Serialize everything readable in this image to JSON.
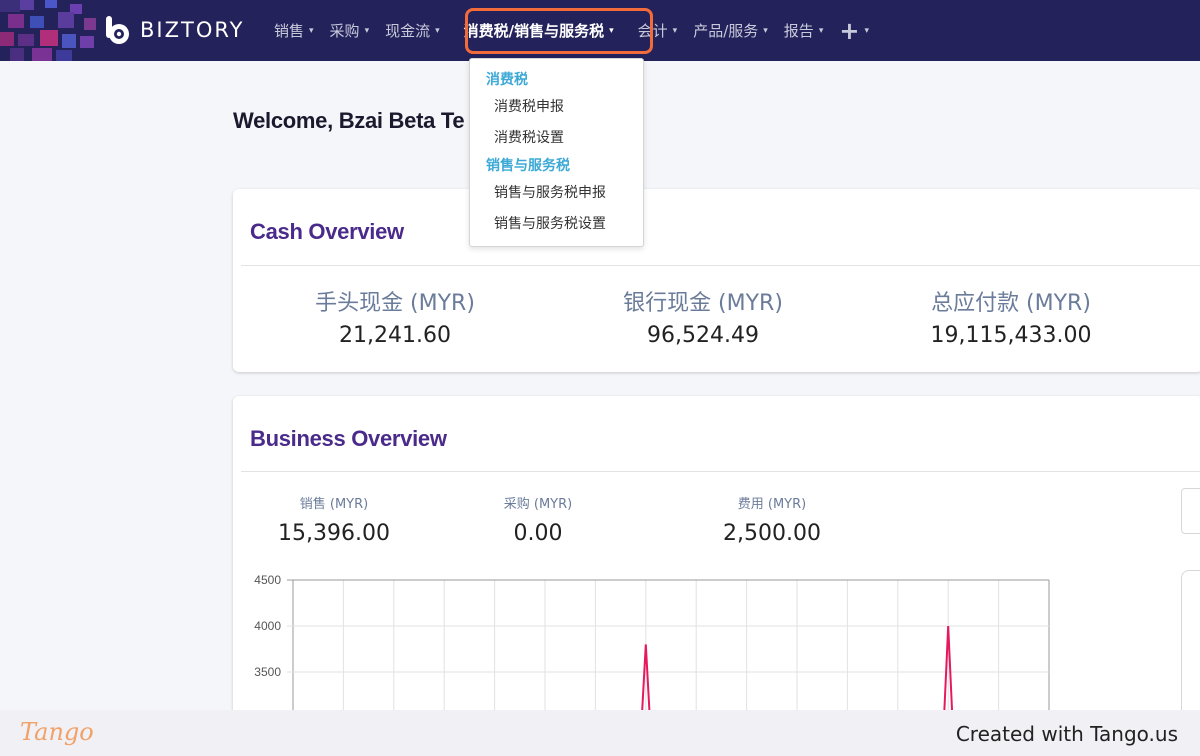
{
  "brand": {
    "name": "BIZTORY",
    "logo_icon": "biztory-b-logo"
  },
  "nav": {
    "items": [
      {
        "label": "销售",
        "active": false
      },
      {
        "label": "采购",
        "active": false
      },
      {
        "label": "现金流",
        "active": false
      },
      {
        "label": "消费税/销售与服务税",
        "active": true
      },
      {
        "label": "会计",
        "active": false
      },
      {
        "label": "产品/服务",
        "active": false
      },
      {
        "label": "报告",
        "active": false
      }
    ],
    "plus_icon": "plus-icon",
    "plus_label": "+",
    "caret": "▾"
  },
  "dropdown": {
    "sections": [
      {
        "header": "消费税",
        "items": [
          "消费税申报",
          "消费税设置"
        ]
      },
      {
        "header": "销售与服务税",
        "items": [
          "销售与服务税申报",
          "销售与服务税设置"
        ]
      }
    ]
  },
  "welcome": {
    "text": "Welcome, Bzai Beta Te"
  },
  "cash_overview": {
    "title": "Cash Overview",
    "columns": [
      {
        "label": "手头现金 (MYR)",
        "value": "21,241.60"
      },
      {
        "label": "银行现金 (MYR)",
        "value": "96,524.49"
      },
      {
        "label": "总应付款 (MYR)",
        "value": "19,115,433.00"
      }
    ]
  },
  "business_overview": {
    "title": "Business Overview",
    "columns": [
      {
        "label": "销售 (MYR)",
        "value": "15,396.00"
      },
      {
        "label": "采购 (MYR)",
        "value": "0.00"
      },
      {
        "label": "费用 (MYR)",
        "value": "2,500.00"
      }
    ]
  },
  "chart_data": {
    "type": "line",
    "y_ticks": [
      4500,
      4000,
      3500
    ],
    "ylim": [
      3000,
      4500
    ],
    "grid": true,
    "series": [
      {
        "color": "#e5195e",
        "peaks": [
          3800,
          4000
        ]
      }
    ]
  },
  "footer": {
    "logo_text": "Tango",
    "credit": "Created with Tango.us"
  },
  "colors": {
    "navbar": "#23225a",
    "highlight": "#f26b3a",
    "card_title": "#4a2a8a",
    "dropdown_header": "#3ca9d6",
    "chart_line": "#e5195e"
  }
}
